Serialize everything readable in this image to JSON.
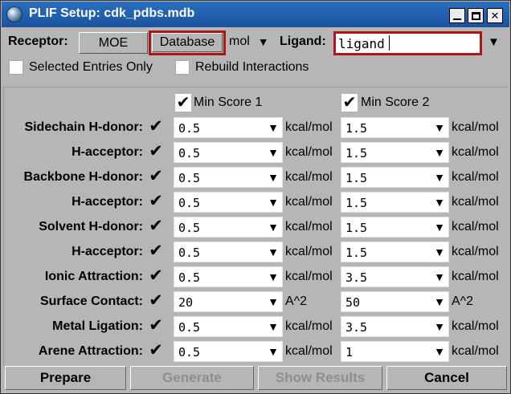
{
  "window": {
    "title": "PLIF Setup: cdk_pdbs.mdb",
    "minimize_icon": "minimize-icon",
    "maximize_icon": "maximize-icon",
    "close_icon": "close-icon"
  },
  "top": {
    "receptor_label": "Receptor:",
    "moe_button": "MOE",
    "database_button": "Database",
    "mol_select": "mol",
    "ligand_label": "Ligand:",
    "ligand_value": "ligand"
  },
  "options": {
    "selected_entries": "Selected Entries Only",
    "rebuild": "Rebuild Interactions"
  },
  "headers": {
    "min_score_1": "Min Score 1",
    "min_score_2": "Min Score 2"
  },
  "rows": [
    {
      "label": "Sidechain H-donor:",
      "v1": "0.5",
      "u1": "kcal/mol",
      "v2": "1.5",
      "u2": "kcal/mol"
    },
    {
      "label": "H-acceptor:",
      "v1": "0.5",
      "u1": "kcal/mol",
      "v2": "1.5",
      "u2": "kcal/mol"
    },
    {
      "label": "Backbone H-donor:",
      "v1": "0.5",
      "u1": "kcal/mol",
      "v2": "1.5",
      "u2": "kcal/mol"
    },
    {
      "label": "H-acceptor:",
      "v1": "0.5",
      "u1": "kcal/mol",
      "v2": "1.5",
      "u2": "kcal/mol"
    },
    {
      "label": "Solvent H-donor:",
      "v1": "0.5",
      "u1": "kcal/mol",
      "v2": "1.5",
      "u2": "kcal/mol"
    },
    {
      "label": "H-acceptor:",
      "v1": "0.5",
      "u1": "kcal/mol",
      "v2": "1.5",
      "u2": "kcal/mol"
    },
    {
      "label": "Ionic Attraction:",
      "v1": "0.5",
      "u1": "kcal/mol",
      "v2": "3.5",
      "u2": "kcal/mol"
    },
    {
      "label": "Surface Contact:",
      "v1": "20",
      "u1": "A^2",
      "v2": "50",
      "u2": "A^2"
    },
    {
      "label": "Metal Ligation:",
      "v1": "0.5",
      "u1": "kcal/mol",
      "v2": "3.5",
      "u2": "kcal/mol"
    },
    {
      "label": "Arene Attraction:",
      "v1": "0.5",
      "u1": "kcal/mol",
      "v2": "1",
      "u2": "kcal/mol"
    }
  ],
  "buttons": {
    "prepare": "Prepare",
    "generate": "Generate",
    "show_results": "Show Results",
    "cancel": "Cancel"
  },
  "colors": {
    "title_bar": "#1b53a0",
    "highlight": "#b01515",
    "disabled_text": "#8e8e8e"
  }
}
